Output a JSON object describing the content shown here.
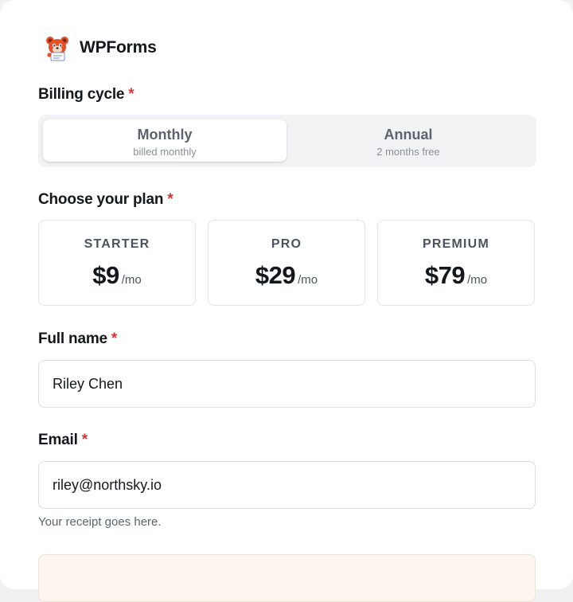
{
  "brand": {
    "name": "WPForms",
    "logo_icon": "bear-mascot-icon"
  },
  "billing": {
    "label": "Billing cycle",
    "required_mark": "*",
    "options": [
      {
        "title": "Monthly",
        "subtitle": "billed monthly",
        "selected": true
      },
      {
        "title": "Annual",
        "subtitle": "2 months free",
        "selected": false
      }
    ]
  },
  "plan": {
    "label": "Choose your plan",
    "required_mark": "*",
    "options": [
      {
        "name": "STARTER",
        "price": "$9",
        "unit": "/mo"
      },
      {
        "name": "PRO",
        "price": "$29",
        "unit": "/mo"
      },
      {
        "name": "PREMIUM",
        "price": "$79",
        "unit": "/mo"
      }
    ]
  },
  "full_name": {
    "label": "Full name",
    "required_mark": "*",
    "value": "Riley Chen"
  },
  "email": {
    "label": "Email",
    "required_mark": "*",
    "value": "riley@northsky.io",
    "help": "Your receipt goes here."
  },
  "colors": {
    "accent_required": "#d63638",
    "text_primary": "#14171c",
    "text_muted": "#5c6370",
    "notice_bg": "#fdf6ef"
  }
}
